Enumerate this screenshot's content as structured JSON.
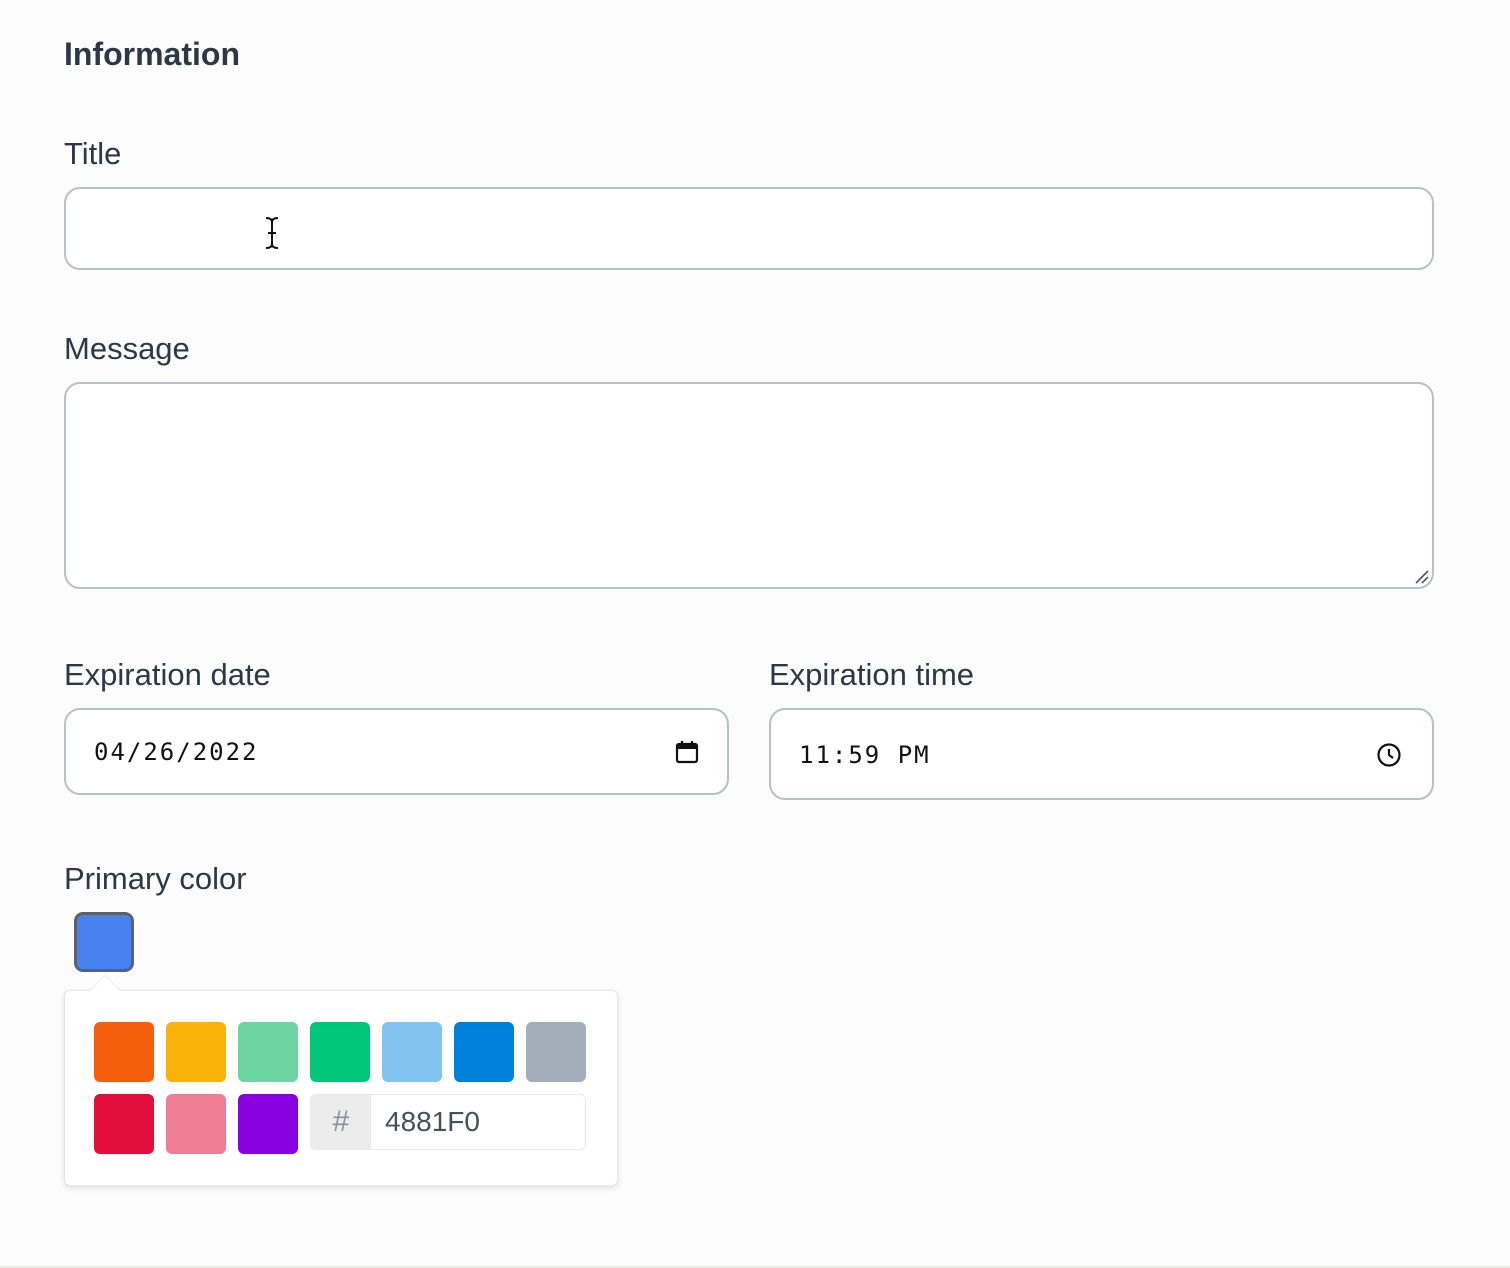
{
  "section": {
    "heading": "Information"
  },
  "title_field": {
    "label": "Title",
    "value": ""
  },
  "message_field": {
    "label": "Message",
    "value": ""
  },
  "expiration_date": {
    "label": "Expiration date",
    "value": "04/26/2022",
    "icon": "calendar-icon"
  },
  "expiration_time": {
    "label": "Expiration time",
    "value": "11:59 PM",
    "icon": "clock-icon"
  },
  "primary_color": {
    "label": "Primary color",
    "selected": "#4881F0",
    "hex_prefix": "#",
    "hex_value": "4881F0",
    "swatches": [
      "#F45E0C",
      "#F9B208",
      "#6ED4A1",
      "#00C77A",
      "#82C3F0",
      "#0082DA",
      "#A2AEBA",
      "#E30E3C",
      "#EF7E94",
      "#8B00E0"
    ]
  }
}
